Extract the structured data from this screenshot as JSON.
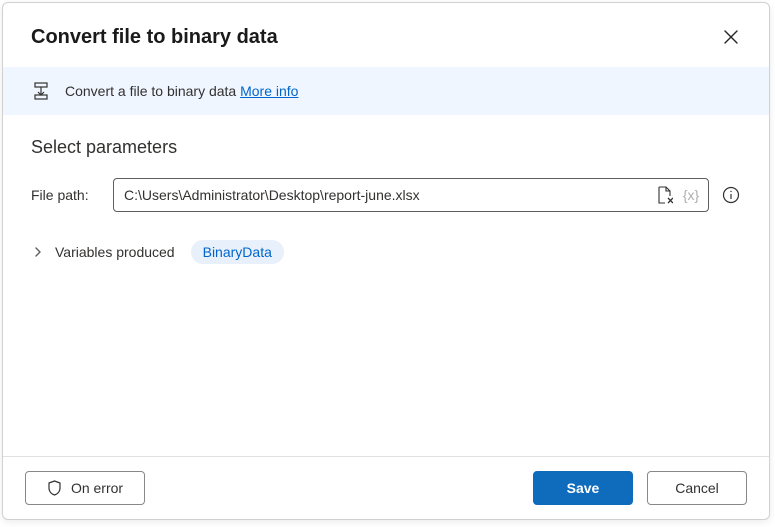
{
  "header": {
    "title": "Convert file to binary data"
  },
  "info": {
    "text": "Convert a file to binary data",
    "link": "More info"
  },
  "section": {
    "title": "Select parameters"
  },
  "params": {
    "file_path_label": "File path:",
    "file_path_value": "C:\\Users\\Administrator\\Desktop\\report-june.xlsx",
    "var_token": "{x}"
  },
  "varsProduced": {
    "label": "Variables produced",
    "chip": "BinaryData"
  },
  "footer": {
    "on_error": "On error",
    "save": "Save",
    "cancel": "Cancel"
  }
}
